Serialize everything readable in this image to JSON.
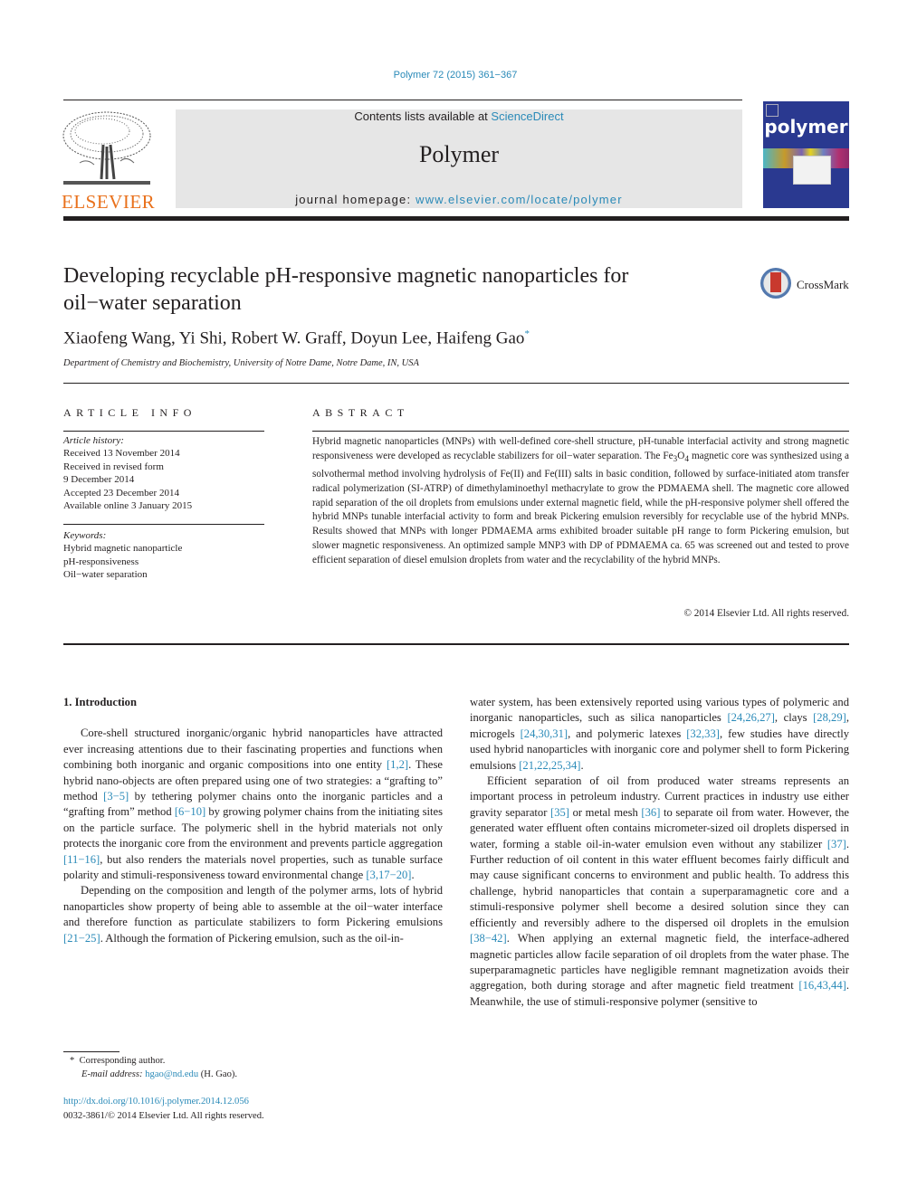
{
  "header": {
    "citation": "Polymer 72 (2015) 361−367",
    "contents_prefix": "Contents lists available at ",
    "contents_link": "ScienceDirect",
    "journal_name": "Polymer",
    "homepage_prefix": "journal homepage: ",
    "homepage_link": "www.elsevier.com/locate/polymer",
    "publisher_logo_text": "ELSEVIER",
    "cover_title": "polymer",
    "colors": {
      "link": "#2a8ab8",
      "elsevier_orange": "#e9711c",
      "cover_blue": "#2a3990",
      "masthead_gray": "#e6e6e6"
    }
  },
  "article": {
    "title_line1": "Developing recyclable pH-responsive magnetic nanoparticles for",
    "title_line2": "oil−water separation",
    "crossmark_label": "CrossMark",
    "authors": "Xiaofeng Wang, Yi Shi, Robert W. Graff, Doyun Lee, Haifeng Gao",
    "corresponding_marker": "*",
    "affiliation": "Department of Chemistry and Biochemistry, University of Notre Dame, Notre Dame, IN, USA"
  },
  "article_info": {
    "heading": "ARTICLE INFO",
    "history_label": "Article history:",
    "history": [
      "Received 13 November 2014",
      "Received in revised form",
      "9 December 2014",
      "Accepted 23 December 2014",
      "Available online 3 January 2015"
    ],
    "keywords_label": "Keywords:",
    "keywords": [
      "Hybrid magnetic nanoparticle",
      "pH-responsiveness",
      "Oil−water separation"
    ]
  },
  "abstract": {
    "heading": "ABSTRACT",
    "part1": "Hybrid magnetic nanoparticles (MNPs) with well-defined core-shell structure, pH-tunable interfacial activity and strong magnetic responsiveness were developed as recyclable stabilizers for oil−water separation. The Fe",
    "sub1": "3",
    "mid": "O",
    "sub2": "4",
    "part2": " magnetic core was synthesized using a solvothermal method involving hydrolysis of Fe(II) and Fe(III) salts in basic condition, followed by surface-initiated atom transfer radical polymerization (SI-ATRP) of dimethylaminoethyl methacrylate to grow the PDMAEMA shell. The magnetic core allowed rapid separation of the oil droplets from emulsions under external magnetic field, while the pH-responsive polymer shell offered the hybrid MNPs tunable interfacial activity to form and break Pickering emulsion reversibly for recyclable use of the hybrid MNPs. Results showed that MNPs with longer PDMAEMA arms exhibited broader suitable pH range to form Pickering emulsion, but slower magnetic responsiveness. An optimized sample MNP3 with DP of PDMAEMA ca. 65 was screened out and tested to prove efficient separation of diesel emulsion droplets from water and the recyclability of the hybrid MNPs.",
    "copyright": "© 2014 Elsevier Ltd. All rights reserved."
  },
  "body": {
    "section_heading": "1.  Introduction",
    "left_paragraphs": [
      [
        {
          "t": "Core-shell structured inorganic/organic hybrid nanoparticles have attracted ever increasing attentions due to their fascinating properties and functions when combining both inorganic and organic compositions into one entity "
        },
        {
          "ref": "[1,2]"
        },
        {
          "t": ". These hybrid nano-objects are often prepared using one of two strategies: a “grafting to” method "
        },
        {
          "ref": "[3−5]"
        },
        {
          "t": " by tethering polymer chains onto the inorganic particles and a “grafting from” method "
        },
        {
          "ref": "[6−10]"
        },
        {
          "t": " by growing polymer chains from the initiating sites on the particle surface. The polymeric shell in the hybrid materials not only protects the inorganic core from the environment and prevents particle aggregation "
        },
        {
          "ref": "[11−16]"
        },
        {
          "t": ", but also renders the materials novel properties, such as tunable surface polarity and stimuli-responsiveness toward environmental change "
        },
        {
          "ref": "[3,17−20]"
        },
        {
          "t": "."
        }
      ],
      [
        {
          "t": "Depending on the composition and length of the polymer arms, lots of hybrid nanoparticles show property of being able to assemble at the oil−water interface and therefore function as particulate stabilizers to form Pickering emulsions "
        },
        {
          "ref": "[21−25]"
        },
        {
          "t": ". Although the formation of Pickering emulsion, such as the oil-in-"
        }
      ]
    ],
    "right_paragraphs": [
      [
        {
          "t": "water system, has been extensively reported using various types of polymeric and inorganic nanoparticles, such as silica nanoparticles "
        },
        {
          "ref": "[24,26,27]"
        },
        {
          "t": ", clays "
        },
        {
          "ref": "[28,29]"
        },
        {
          "t": ", microgels "
        },
        {
          "ref": "[24,30,31]"
        },
        {
          "t": ", and polymeric latexes "
        },
        {
          "ref": "[32,33]"
        },
        {
          "t": ", few studies have directly used hybrid nanoparticles with inorganic core and polymer shell to form Pickering emulsions "
        },
        {
          "ref": "[21,22,25,34]"
        },
        {
          "t": "."
        }
      ],
      [
        {
          "t": "Efficient separation of oil from produced water streams represents an important process in petroleum industry. Current practices in industry use either gravity separator "
        },
        {
          "ref": "[35]"
        },
        {
          "t": " or metal mesh "
        },
        {
          "ref": "[36]"
        },
        {
          "t": " to separate oil from water. However, the generated water effluent often contains micrometer-sized oil droplets dispersed in water, forming a stable oil-in-water emulsion even without any stabilizer "
        },
        {
          "ref": "[37]"
        },
        {
          "t": ". Further reduction of oil content in this water effluent becomes fairly difficult and may cause significant concerns to environment and public health. To address this challenge, hybrid nanoparticles that contain a superparamagnetic core and a stimuli-responsive polymer shell become a desired solution since they can efficiently and reversibly adhere to the dispersed oil droplets in the emulsion "
        },
        {
          "ref": "[38−42]"
        },
        {
          "t": ". When applying an external magnetic field, the interface-adhered magnetic particles allow facile separation of oil droplets from the water phase. The superparamagnetic particles have negligible remnant magnetization avoids their aggregation, both during storage and after magnetic field treatment "
        },
        {
          "ref": "[16,43,44]"
        },
        {
          "t": ". Meanwhile, the use of stimuli-responsive polymer (sensitive to"
        }
      ]
    ]
  },
  "footnote": {
    "marker": "*",
    "corresponding": "Corresponding author.",
    "email_label": "E-mail address: ",
    "email": "hgao@nd.edu",
    "email_suffix": " (H. Gao)."
  },
  "doi": {
    "link": "http://dx.doi.org/10.1016/j.polymer.2014.12.056",
    "issn_line": "0032-3861/© 2014 Elsevier Ltd. All rights reserved."
  }
}
